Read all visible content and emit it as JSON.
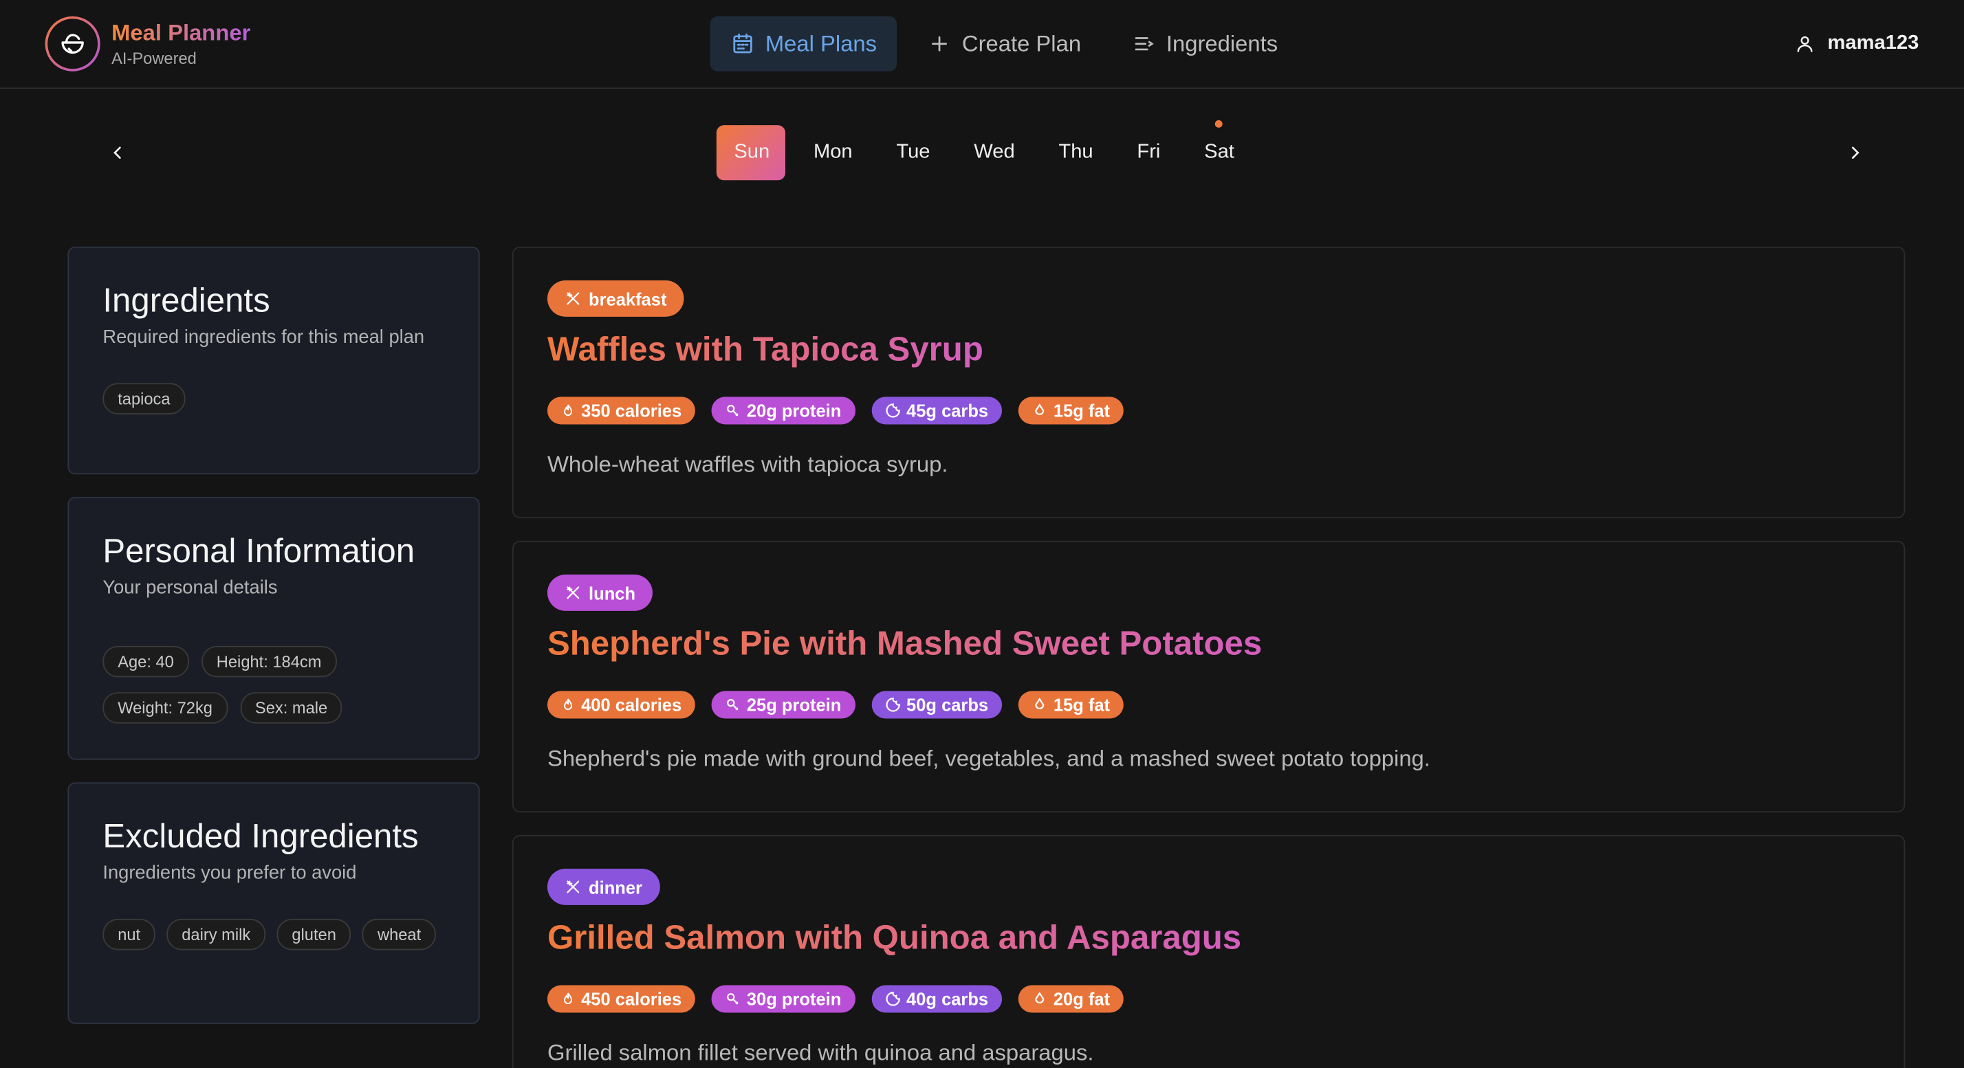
{
  "brand": {
    "title": "Meal Planner",
    "subtitle": "AI-Powered",
    "icon": "salad-bowl-icon"
  },
  "nav": [
    {
      "label": "Meal Plans",
      "icon": "calendar-icon",
      "active": true
    },
    {
      "label": "Create Plan",
      "icon": "plus-icon",
      "active": false
    },
    {
      "label": "Ingredients",
      "icon": "list-icon",
      "active": false
    }
  ],
  "user": {
    "name": "mama123",
    "icon": "user-icon"
  },
  "days": [
    "Sun",
    "Mon",
    "Tue",
    "Wed",
    "Thu",
    "Fri",
    "Sat"
  ],
  "active_day": "Sun",
  "marked_day": "Sat",
  "colors": {
    "accent_orange": "#f0793b",
    "accent_pink": "#d35ec0",
    "accent_purple": "#8a55dc",
    "nav_active": "#6aa5e8"
  },
  "ingredients_card": {
    "title": "Ingredients",
    "subtitle": "Required ingredients for this meal plan",
    "items": [
      "tapioca"
    ]
  },
  "personal_card": {
    "title": "Personal Information",
    "subtitle": "Your personal details",
    "items": [
      "Age: 40",
      "Height: 184cm",
      "Weight: 72kg",
      "Sex: male"
    ]
  },
  "excluded_card": {
    "title": "Excluded Ingredients",
    "subtitle": "Ingredients you prefer to avoid",
    "items": [
      "nut",
      "dairy milk",
      "gluten",
      "wheat"
    ]
  },
  "meals": [
    {
      "type": "breakfast",
      "title": "Waffles with Tapioca Syrup",
      "calories": "350 calories",
      "protein": "20g protein",
      "carbs": "45g carbs",
      "fat": "15g fat",
      "description": "Whole-wheat waffles with tapioca syrup."
    },
    {
      "type": "lunch",
      "title": "Shepherd's Pie with Mashed Sweet Potatoes",
      "calories": "400 calories",
      "protein": "25g protein",
      "carbs": "50g carbs",
      "fat": "15g fat",
      "description": "Shepherd's pie made with ground beef, vegetables, and a mashed sweet potato topping."
    },
    {
      "type": "dinner",
      "title": "Grilled Salmon with Quinoa and Asparagus",
      "calories": "450 calories",
      "protein": "30g protein",
      "carbs": "40g carbs",
      "fat": "20g fat",
      "description": "Grilled salmon fillet served with quinoa and asparagus."
    }
  ]
}
